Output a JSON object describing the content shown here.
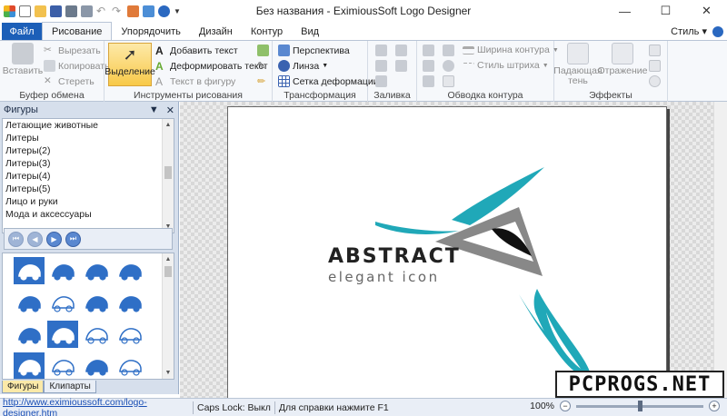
{
  "window": {
    "title": "Без названия - EximiousSoft Logo Designer",
    "minimize": "—",
    "maximize": "☐",
    "close": "✕"
  },
  "tabs": [
    {
      "label": "Файл"
    },
    {
      "label": "Рисование"
    },
    {
      "label": "Упорядочить"
    },
    {
      "label": "Дизайн"
    },
    {
      "label": "Контур"
    },
    {
      "label": "Вид"
    }
  ],
  "style_menu": "Стиль ▾",
  "ribbon": {
    "clipboard": {
      "label": "Буфер обмена",
      "paste": "Вставить",
      "cut": "Вырезать",
      "copy": "Копировать",
      "erase": "Стереть"
    },
    "drawing": {
      "label": "Инструменты рисования",
      "select": "Выделение",
      "add_text": "Добавить текст",
      "warp_text": "Деформировать текст",
      "text_to_shape": "Текст в фигуру"
    },
    "transform": {
      "label": "Трансформация",
      "perspective": "Перспектива",
      "lens": "Линза",
      "warp_grid": "Сетка деформации"
    },
    "fill": {
      "label": "Заливка"
    },
    "stroke": {
      "label": "Обводка контура",
      "stroke_width": "Ширина контура",
      "stroke_style": "Стиль штриха"
    },
    "effects": {
      "label": "Эффекты",
      "drop_shadow": "Падающая тень",
      "reflection": "Отражение"
    }
  },
  "panel": {
    "title": "Фигуры",
    "categories": [
      "Летающие животные",
      "Литеры",
      "Литеры(2)",
      "Литеры(3)",
      "Литеры(4)",
      "Литеры(5)",
      "Лицо и руки",
      "Мода и аксессуары"
    ],
    "tabs": [
      "Фигуры",
      "Клипарты"
    ]
  },
  "canvas": {
    "logo_title": "ABSTRACT",
    "logo_subtitle": "elegant icon",
    "colors": {
      "teal": "#20a8b8",
      "gray": "#888888",
      "black": "#111111"
    }
  },
  "watermark": "PCPROGS.NET",
  "status": {
    "url": "http://www.eximioussoft.com/logo-designer.htm",
    "caps_lock": "Caps Lock: Выкл",
    "help": "Для справки нажмите F1",
    "zoom_percent": "100%",
    "zoom_fraction": 0.5
  }
}
